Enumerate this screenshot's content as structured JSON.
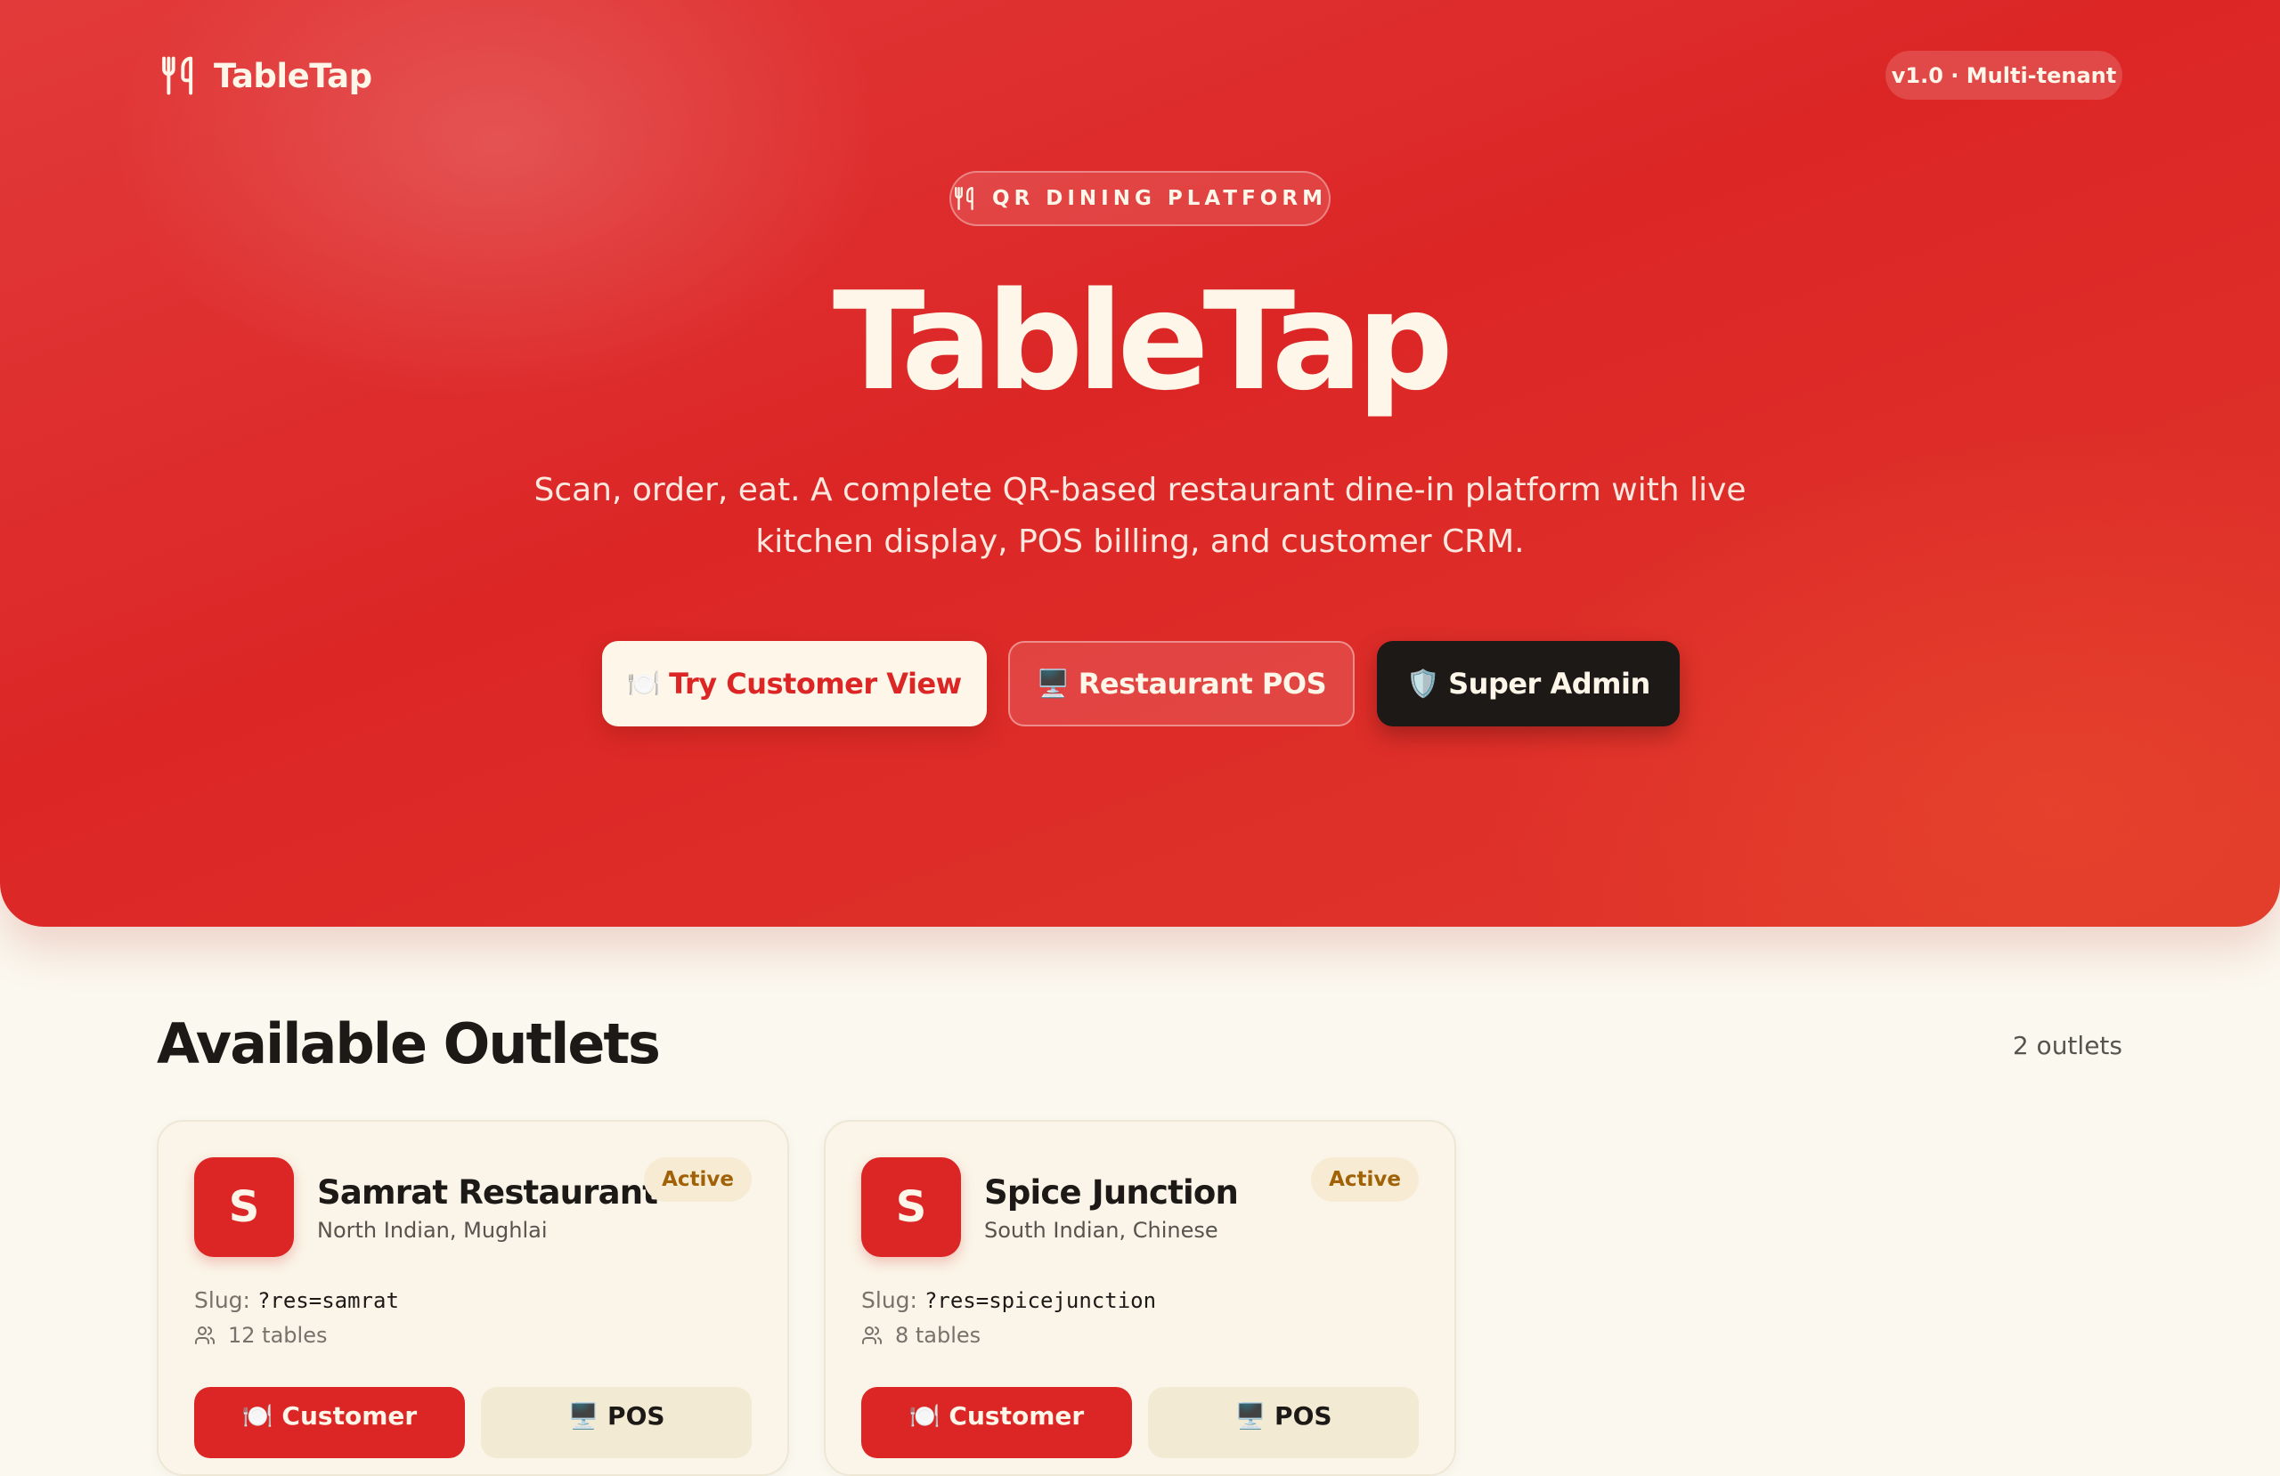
{
  "header": {
    "brand_name": "TableTap",
    "version_badge": "v1.0 · Multi-tenant"
  },
  "hero": {
    "eyebrow": "QR DINING PLATFORM",
    "title": "TableTap",
    "subtitle_line1": "Scan, order, eat. A complete QR-based restaurant dine-in platform with live",
    "subtitle_line2": "kitchen display, POS billing, and customer CRM.",
    "buttons": [
      {
        "glyph": "🍽️",
        "label": "Try Customer View"
      },
      {
        "glyph": "🖥️",
        "label": "Restaurant POS"
      },
      {
        "glyph": "🛡️",
        "label": "Super Admin"
      }
    ]
  },
  "outlets": {
    "title": "Available Outlets",
    "count_label": "2 outlets",
    "items": [
      {
        "initial": "S",
        "name": "Samrat Restaurant",
        "cuisine": "North Indian, Mughlai",
        "status": "Active",
        "slug_label": "Slug:",
        "slug": "?res=samrat",
        "tables": "12 tables",
        "customer_label": "🍽️ Customer",
        "pos_label": "🖥️ POS"
      },
      {
        "initial": "S",
        "name": "Spice Junction",
        "cuisine": "South Indian, Chinese",
        "status": "Active",
        "slug_label": "Slug:",
        "slug": "?res=spicejunction",
        "tables": "8 tables",
        "customer_label": "🍽️ Customer",
        "pos_label": "🖥️ POS"
      }
    ]
  },
  "icons": {
    "brand_icon": "utensils-icon",
    "eyebrow_icon": "utensils-icon",
    "tables_icon": "users-icon"
  },
  "colors": {
    "brand_red": "#dc2626",
    "cream": "#fdf6e9",
    "dark": "#1c1917",
    "badge_text": "#a16207",
    "page_bg": "#fbf8ef"
  }
}
